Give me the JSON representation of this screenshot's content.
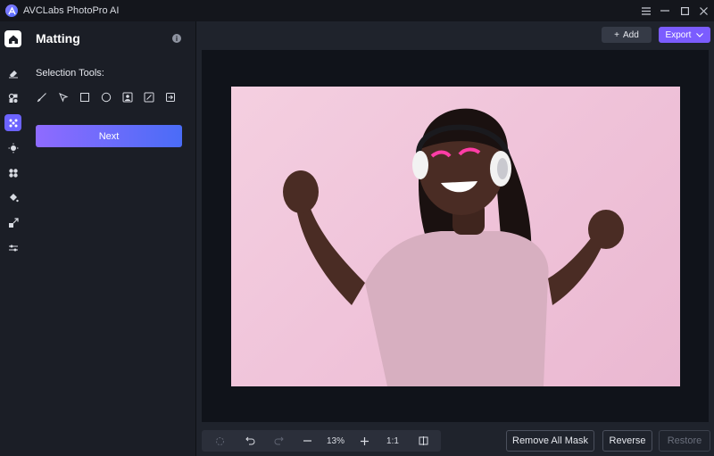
{
  "app": {
    "title": "AVCLabs PhotoPro AI"
  },
  "window_controls": [
    {
      "name": "menu-icon",
      "glyph": "☰"
    },
    {
      "name": "minimize-icon",
      "glyph": "—"
    },
    {
      "name": "maximize-icon",
      "glyph": "☐"
    },
    {
      "name": "close-icon",
      "glyph": "✕"
    }
  ],
  "rail": {
    "items": [
      {
        "name": "home-icon"
      },
      {
        "name": "eraser-icon"
      },
      {
        "name": "shapes-icon"
      },
      {
        "name": "matting-icon",
        "active": true
      },
      {
        "name": "enhance-icon"
      },
      {
        "name": "fan-icon"
      },
      {
        "name": "paint-bucket-icon"
      },
      {
        "name": "upscale-icon"
      },
      {
        "name": "adjust-sliders-icon"
      }
    ]
  },
  "panel": {
    "title": "Matting",
    "tools_label": "Selection Tools:",
    "tools": [
      "brush-icon",
      "select-arrow-icon",
      "rectangle-select-icon",
      "ellipse-select-icon",
      "portrait-select-icon",
      "edit-icon",
      "import-icon"
    ],
    "next_label": "Next"
  },
  "toolbar": {
    "add_label": "Add",
    "export_label": "Export"
  },
  "zoom": {
    "level": "13%",
    "ratio": "1:1"
  },
  "actions": {
    "remove_all_mask": "Remove All Mask",
    "reverse": "Reverse",
    "restore": "Restore"
  },
  "colors": {
    "accent": "#7b5cff",
    "next_gradient_start": "#8f6bff",
    "next_gradient_end": "#4a6cf7",
    "photo_background": "#f0c4da"
  }
}
